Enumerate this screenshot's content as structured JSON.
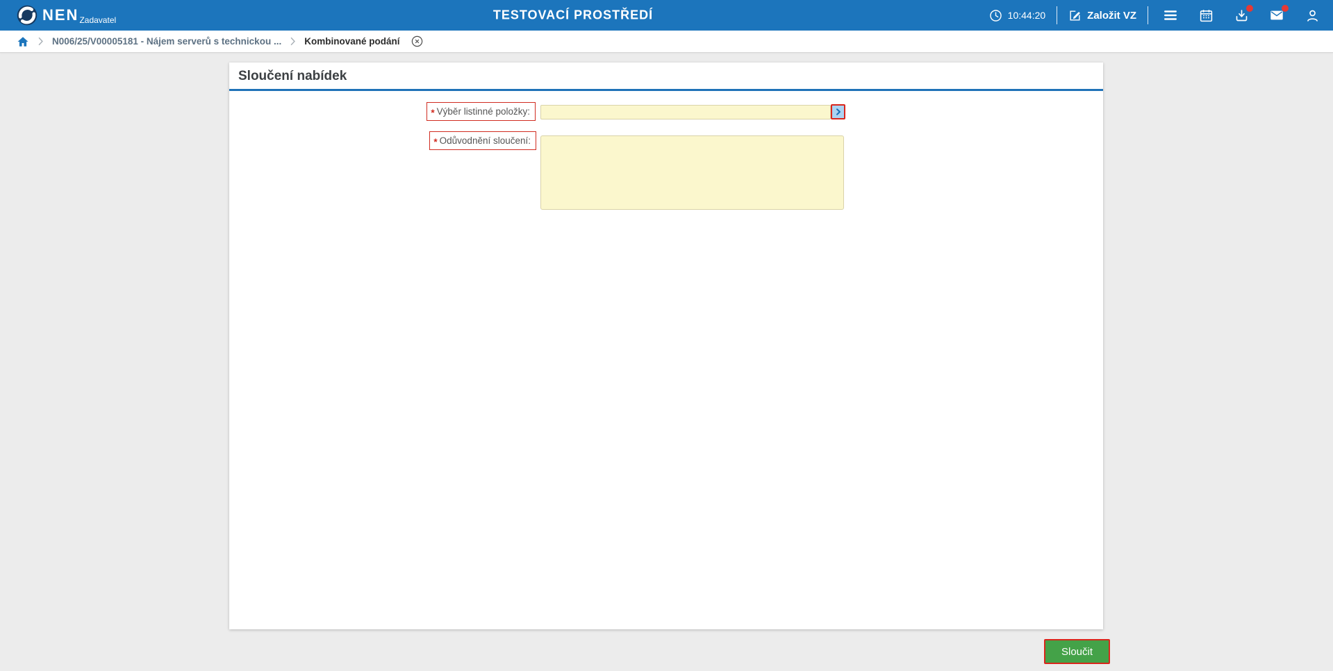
{
  "header": {
    "logo_text": "NEN",
    "logo_subtitle": "Zadavatel",
    "environment_title": "TESTOVACÍ PROSTŘEDÍ",
    "time": "10:44:20",
    "create_vz_label": "Založit VZ",
    "notifications": {
      "download_badge": true,
      "mail_badge": true
    }
  },
  "breadcrumb": {
    "items": [
      {
        "label": "N006/25/V00005181 - Nájem serverů s technickou ..."
      },
      {
        "label": "Kombinované podání"
      }
    ]
  },
  "main": {
    "title": "Sloučení nabídek",
    "required_marker": "*",
    "form": {
      "fields": [
        {
          "label": "Výběr listinné položky:",
          "required": true,
          "value": ""
        },
        {
          "label": "Odůvodnění sloučení:",
          "required": true,
          "value": ""
        }
      ]
    }
  },
  "footer": {
    "submit_label": "Sloučit"
  },
  "icons": {
    "nen-logo-icon": "swirl-circle",
    "clock-icon": "◷",
    "edit-icon": "✎",
    "menu-icon": "≡",
    "calendar-icon": "▦",
    "download-icon": "⤓",
    "mail-icon": "✉",
    "user-icon": "user-silhouette",
    "home-icon": "⌂",
    "chevron-icon": "›",
    "close-icon": "×",
    "lookup-icon": "›"
  },
  "colors": {
    "header_bg": "#1c75bc",
    "accent_blue": "#1f72b8",
    "badge_red": "#e53935",
    "field_bg": "#fbf7cd",
    "required_red": "#d02b20",
    "submit_green": "#44a248"
  }
}
